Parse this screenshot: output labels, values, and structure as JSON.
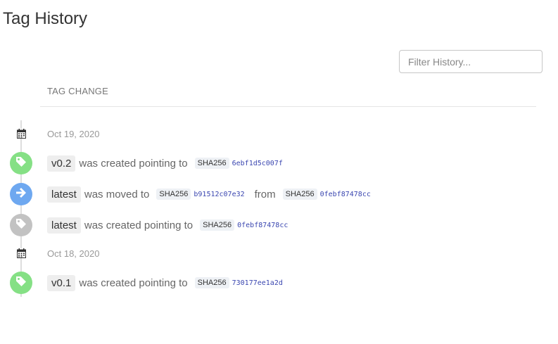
{
  "page": {
    "title": "Tag History"
  },
  "filter": {
    "placeholder": "Filter History..."
  },
  "table": {
    "column_header": "TAG CHANGE"
  },
  "colors": {
    "created": "#85e085",
    "moved": "#6ea8f0",
    "created_old": "#c2c2c2",
    "sha_link": "#3a46b0"
  },
  "entries": [
    {
      "kind": "date",
      "date": "Oct 19, 2020",
      "icon": "calendar-icon"
    },
    {
      "kind": "change",
      "tag": "v0.2",
      "action": "was created pointing to",
      "sha_label": "SHA256",
      "sha": "6ebf1d5c007f",
      "icon": "tag-icon",
      "color": "#85e085"
    },
    {
      "kind": "change",
      "tag": "latest",
      "action": "was moved to",
      "sha_label": "SHA256",
      "sha": "b91512c07e32",
      "from_text": "from",
      "from_sha_label": "SHA256",
      "from_sha": "0febf87478cc",
      "icon": "arrow-right-icon",
      "color": "#6ea8f0"
    },
    {
      "kind": "change",
      "tag": "latest",
      "action": "was created pointing to",
      "sha_label": "SHA256",
      "sha": "0febf87478cc",
      "icon": "tag-icon",
      "color": "#c2c2c2"
    },
    {
      "kind": "date",
      "date": "Oct 18, 2020",
      "icon": "calendar-icon"
    },
    {
      "kind": "change",
      "tag": "v0.1",
      "action": "was created pointing to",
      "sha_label": "SHA256",
      "sha": "730177ee1a2d",
      "icon": "tag-icon",
      "color": "#85e085"
    }
  ]
}
